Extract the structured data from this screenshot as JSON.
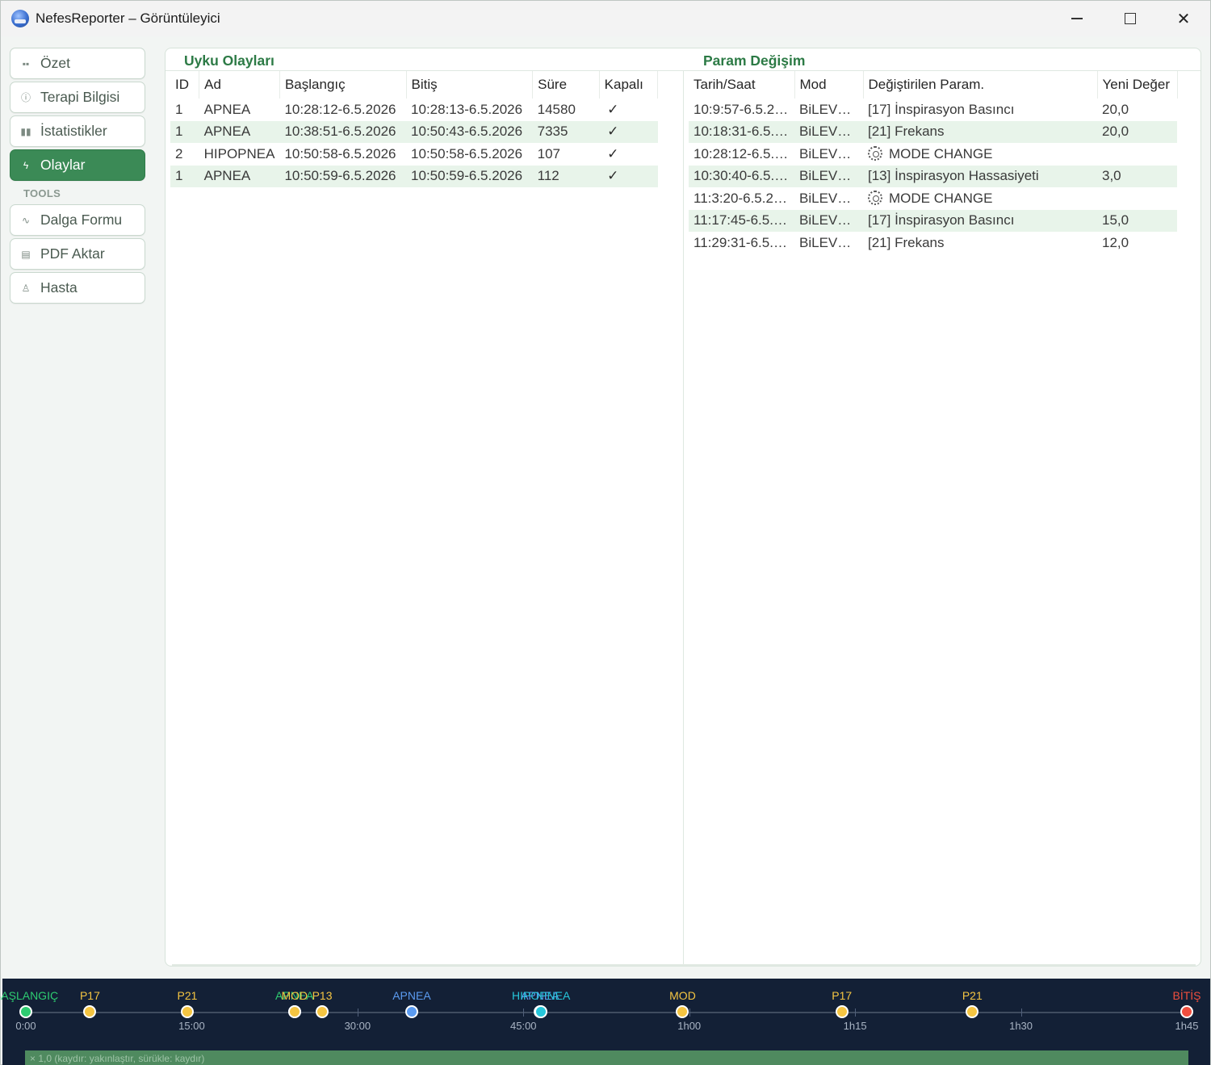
{
  "window": {
    "title": "NefesReporter – Görüntüleyici",
    "controls": {
      "minimize": "minimize",
      "maximize": "maximize",
      "close": "close"
    }
  },
  "sidebar": {
    "items": [
      {
        "label": "Özet",
        "icon": "grid-icon",
        "active": false
      },
      {
        "label": "Terapi Bilgisi",
        "icon": "info-icon",
        "active": false
      },
      {
        "label": "İstatistikler",
        "icon": "bar-chart-icon",
        "active": false
      },
      {
        "label": "Olaylar",
        "icon": "lightning-icon",
        "active": true
      }
    ],
    "tools_label": "TOOLS",
    "tools": [
      {
        "label": "Dalga Formu",
        "icon": "waveform-icon"
      },
      {
        "label": "PDF Aktar",
        "icon": "document-icon"
      },
      {
        "label": "Hasta",
        "icon": "user-icon"
      }
    ]
  },
  "events": {
    "title": "Uyku Olayları",
    "columns": [
      "ID",
      "Ad",
      "Başlangıç",
      "Bitiş",
      "Süre",
      "Kapalı"
    ],
    "rows": [
      {
        "id": "1",
        "name": "APNEA",
        "start": "10:28:12-6.5.2026",
        "end": "10:28:13-6.5.2026",
        "duration": "14580",
        "closed": "✓"
      },
      {
        "id": "1",
        "name": "APNEA",
        "start": "10:38:51-6.5.2026",
        "end": "10:50:43-6.5.2026",
        "duration": "7335",
        "closed": "✓"
      },
      {
        "id": "2",
        "name": "HIPOPNEA",
        "start": "10:50:58-6.5.2026",
        "end": "10:50:58-6.5.2026",
        "duration": "107",
        "closed": "✓"
      },
      {
        "id": "1",
        "name": "APNEA",
        "start": "10:50:59-6.5.2026",
        "end": "10:50:59-6.5.2026",
        "duration": "112",
        "closed": "✓"
      }
    ]
  },
  "params": {
    "title": "Param Değişim",
    "columns": [
      "Tarih/Saat",
      "Mod",
      "Değiştirilen Param.",
      "Yeni Değer"
    ],
    "rows": [
      {
        "time": "10:9:57-6.5.20...",
        "mode": "BiLEVEL-T",
        "param": "[17] İnspirasyon Basıncı",
        "value": "20,0",
        "icon": ""
      },
      {
        "time": "10:18:31-6.5.2...",
        "mode": "BiLEVEL-T",
        "param": "[21] Frekans",
        "value": "20,0",
        "icon": ""
      },
      {
        "time": "10:28:12-6.5.2...",
        "mode": "BiLEVEL S",
        "param": "MODE CHANGE",
        "value": "",
        "icon": "gear-icon"
      },
      {
        "time": "10:30:40-6.5.2...",
        "mode": "BiLEVEL S",
        "param": "[13] İnspirasyon Hassasiyeti",
        "value": "3,0",
        "icon": ""
      },
      {
        "time": "11:3:20-6.5.20...",
        "mode": "BiLEVEL-T",
        "param": "MODE CHANGE",
        "value": "",
        "icon": "gear-icon"
      },
      {
        "time": "11:17:45-6.5.2...",
        "mode": "BiLEVEL-T",
        "param": "[17] İnspirasyon Basıncı",
        "value": "15,0",
        "icon": ""
      },
      {
        "time": "11:29:31-6.5.2...",
        "mode": "BiLEVEL-T",
        "param": "[21] Frekans",
        "value": "12,0",
        "icon": ""
      }
    ]
  },
  "timeline": {
    "total_minutes": 105,
    "ticks": [
      {
        "minutes": 0,
        "label": "0:00"
      },
      {
        "minutes": 15,
        "label": "15:00"
      },
      {
        "minutes": 30,
        "label": "30:00"
      },
      {
        "minutes": 45,
        "label": "45:00"
      },
      {
        "minutes": 60,
        "label": "1h00"
      },
      {
        "minutes": 75,
        "label": "1h15"
      },
      {
        "minutes": 90,
        "label": "1h30"
      },
      {
        "minutes": 105,
        "label": "1h45"
      }
    ],
    "markers": [
      {
        "minutes": 0,
        "label": "BAŞLANGIÇ",
        "color": "#2ecc71"
      },
      {
        "minutes": 5.8,
        "label": "P17",
        "color": "#f5c542"
      },
      {
        "minutes": 14.6,
        "label": "P21",
        "color": "#f5c542"
      },
      {
        "minutes": 24.3,
        "label": "APNEA",
        "color": "#2ecc71"
      },
      {
        "minutes": 24.3,
        "label": "MOD",
        "color": "#f5c542"
      },
      {
        "minutes": 26.8,
        "label": "P13",
        "color": "#f5c542"
      },
      {
        "minutes": 34.9,
        "label": "APNEA",
        "color": "#5b9bf0"
      },
      {
        "minutes": 46.5,
        "label": "APNEA",
        "color": "#5b9bf0"
      },
      {
        "minutes": 46.6,
        "label": "HIPOPNEA",
        "color": "#26c6da"
      },
      {
        "minutes": 59.4,
        "label": "MOD",
        "color": "#f5c542"
      },
      {
        "minutes": 73.8,
        "label": "P17",
        "color": "#f5c542"
      },
      {
        "minutes": 85.6,
        "label": "P21",
        "color": "#f5c542"
      },
      {
        "minutes": 105,
        "label": "BİTİŞ",
        "color": "#f04e3e"
      }
    ],
    "hint": "× 1,0  (kaydır: yakınlaştır, sürükle: kaydır)"
  },
  "colors": {
    "accent": "#3b8a56",
    "row_alt": "#e8f4ea",
    "timeline_bg": "#132036"
  }
}
